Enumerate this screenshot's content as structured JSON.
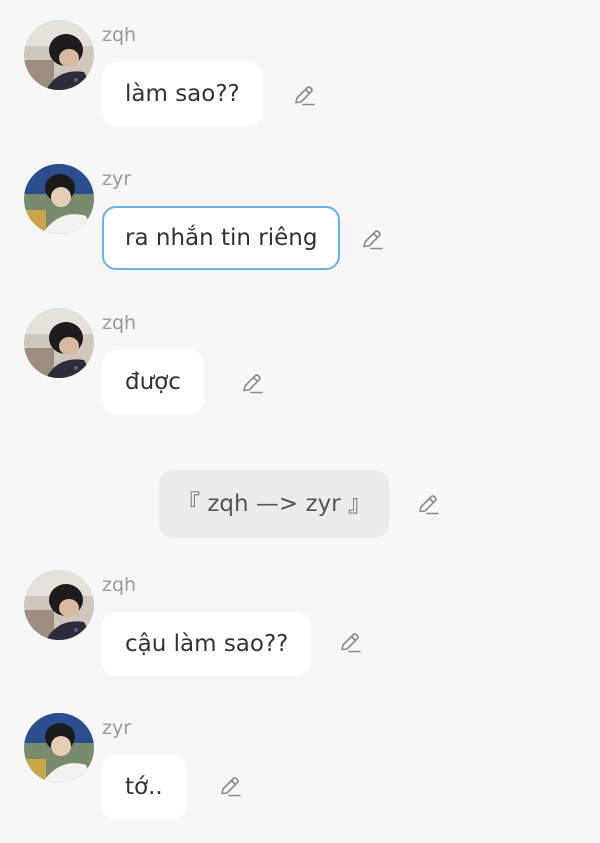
{
  "messages": [
    {
      "sender": "zqh",
      "text": "làm sao??",
      "avatar": "zqh-avatar"
    },
    {
      "sender": "zyr",
      "text": "ra nhắn tin riêng",
      "avatar": "zyr-avatar"
    },
    {
      "sender": "zqh",
      "text": "được",
      "avatar": "zqh-avatar"
    },
    {
      "sender": "zqh",
      "text": "cậu làm sao??",
      "avatar": "zqh-avatar"
    },
    {
      "sender": "zyr",
      "text": "tớ..",
      "avatar": "zyr-avatar"
    }
  ],
  "system_notice": {
    "text": "『 zqh —> zyr 』"
  },
  "icons": {
    "edit": "pencil-edit-icon"
  },
  "colors": {
    "background": "#f7f7f7",
    "bubble": "#ffffff",
    "selected_border": "#6bb2e2",
    "name": "#9a9a9a",
    "system_bubble": "#ececec"
  }
}
